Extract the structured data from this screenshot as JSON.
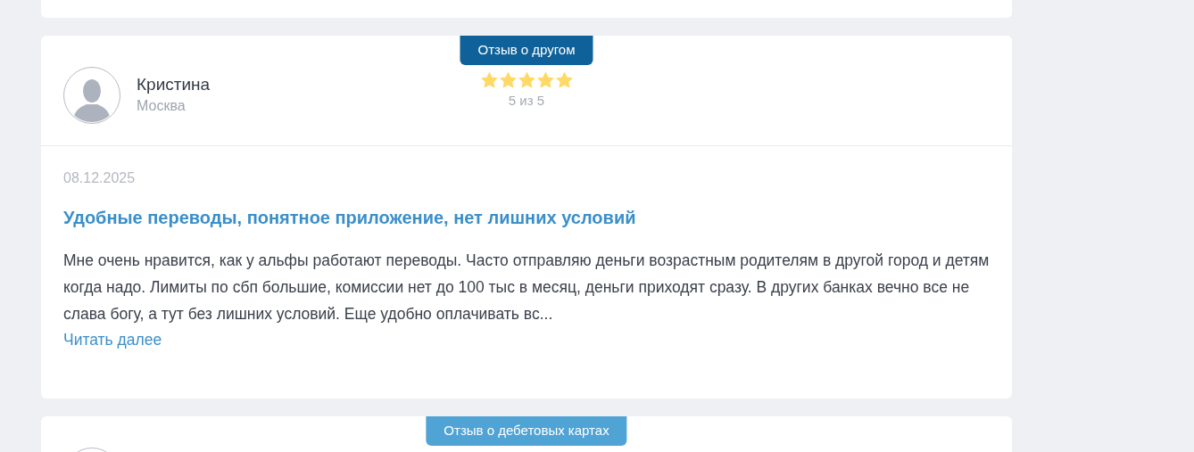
{
  "reviews": [
    {
      "badge": "Отзыв о другом",
      "color": "#0e6199",
      "author": "Кристина",
      "city": "Москва",
      "stars": 5,
      "rating": "5 из 5",
      "date": "08.12.2025",
      "title": "Удобные переводы, понятное приложение, нет лишних условий",
      "text": "Мне очень нравится, как у альфы работают переводы. Часто отправляю деньги возрастным родителям в другой город и детям когда надо. Лимиты по сбп большие, комиссии нет до 100 тыс в месяц, деньги приходят сразу. В других банках вечно все не слава богу, а тут без лишних условий. Еще удобно оплачивать вс...",
      "more": "Читать далее"
    },
    {
      "badge": "Отзыв о дебетовых картах",
      "color": "#4fa3d5"
    }
  ]
}
